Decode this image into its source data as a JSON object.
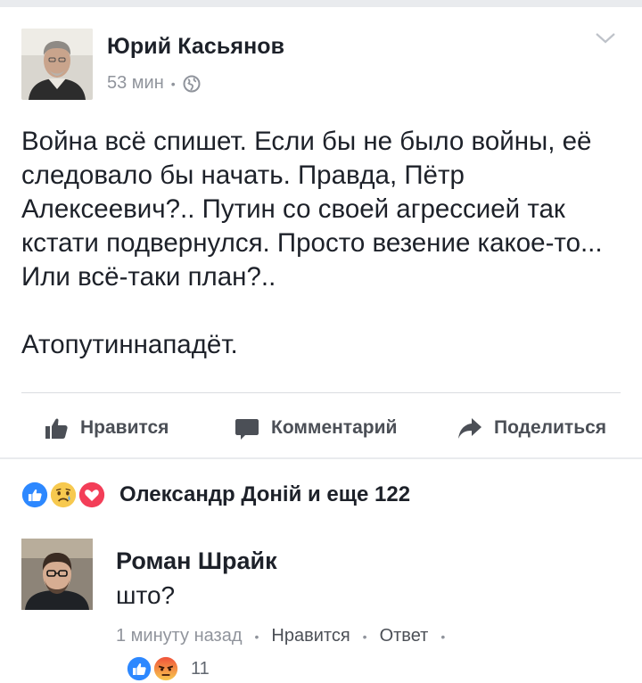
{
  "post": {
    "author": "Юрий Касьянов",
    "time": "53 мин",
    "dot": "•",
    "paragraphs": [
      "Война всё спишет. Если бы не было войны, её следовало бы начать. Правда, Пётр Алексеевич?.. Путин со своей агрессией так кстати подвернулся. Просто везение какое-то... Или всё-таки план?..",
      "Атопутиннападёт."
    ]
  },
  "actions": {
    "like": "Нравится",
    "comment": "Комментарий",
    "share": "Поделиться"
  },
  "reactions": {
    "summary": "Олександр Доній и еще 122",
    "icons": [
      "like-icon",
      "sad-icon",
      "love-icon"
    ]
  },
  "comment": {
    "author": "Роман Шрайк",
    "text": "што?",
    "time": "1 минуту назад",
    "like": "Нравится",
    "reply": "Ответ",
    "dot": "•",
    "reaction_count": "11",
    "reaction_icons": [
      "like-icon",
      "angry-icon"
    ]
  },
  "colors": {
    "brand_blue": "#4267b2",
    "like_blue": "#2d88ff",
    "love_red": "#f33e58",
    "muted": "#90949c",
    "text": "#1d2129"
  }
}
